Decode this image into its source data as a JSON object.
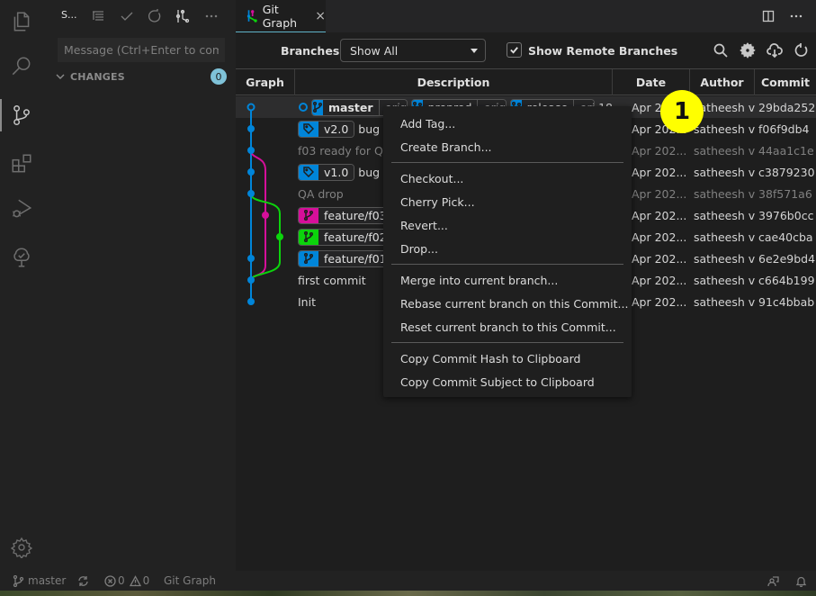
{
  "activity_bar": {
    "items": [
      {
        "name": "explorer",
        "icon": "files-icon"
      },
      {
        "name": "search",
        "icon": "search-icon"
      },
      {
        "name": "source-control",
        "icon": "source-control-icon",
        "active": true
      },
      {
        "name": "extensions",
        "icon": "extensions-icon"
      },
      {
        "name": "run-debug",
        "icon": "run-debug-icon"
      },
      {
        "name": "testing",
        "icon": "testing-tree-icon"
      }
    ],
    "settings_icon": "gear-icon"
  },
  "sidebar": {
    "title": "S...",
    "actions": [
      "view-as-tree-icon",
      "commit-check-icon",
      "refresh-icon",
      "git-graph-icon",
      "more-icon"
    ],
    "message_placeholder": "Message (Ctrl+Enter to com...",
    "changes_label": "CHANGES",
    "changes_count": "0"
  },
  "tab": {
    "label": "Git Graph",
    "close": "×"
  },
  "controls": {
    "branches_label": "Branches:",
    "branches_value": "Show All",
    "show_remote_label": "Show Remote Branches",
    "show_remote_checked": true
  },
  "table": {
    "headers": [
      "Graph",
      "Description",
      "Date",
      "Author",
      "Commit"
    ],
    "rows": [
      {
        "refs": [
          {
            "type": "branch",
            "name": "master",
            "remote": "origin",
            "color": "#0085d9",
            "bold": true
          },
          {
            "type": "branch",
            "name": "preprod",
            "remote": "origin",
            "color": "#0085d9"
          },
          {
            "type": "branch",
            "name": "release",
            "remote": "orig",
            "color": "#0085d9"
          }
        ],
        "message": "18",
        "date": "Apr 20...",
        "author": "satheesh v",
        "commit": "29bda252",
        "dim": false,
        "selected": true
      },
      {
        "refs": [
          {
            "type": "tag",
            "name": "v2.0",
            "color": "#0085d9"
          }
        ],
        "message": "bug fix",
        "date": "Apr 202...",
        "author": "satheesh v",
        "commit": "f06f9db4",
        "dim": false
      },
      {
        "refs": [],
        "message": "f03 ready for QA",
        "date": "Apr 202...",
        "author": "satheesh v",
        "commit": "44aa1c1e",
        "dim": true
      },
      {
        "refs": [
          {
            "type": "tag",
            "name": "v1.0",
            "color": "#0085d9"
          }
        ],
        "message": "bug fix",
        "date": "Apr 202...",
        "author": "satheesh v",
        "commit": "c3879230",
        "dim": false
      },
      {
        "refs": [],
        "message": "QA drop",
        "date": "Apr 202...",
        "author": "satheesh v",
        "commit": "38f571a6",
        "dim": true
      },
      {
        "refs": [
          {
            "type": "branch",
            "name": "feature/f03",
            "color": "#d60f9a"
          }
        ],
        "message": "",
        "date": "Apr 202...",
        "author": "satheesh v",
        "commit": "3976b0cc",
        "dim": false
      },
      {
        "refs": [
          {
            "type": "branch",
            "name": "feature/f02",
            "color": "#0cd40c"
          }
        ],
        "message": "",
        "date": "Apr 202...",
        "author": "satheesh v",
        "commit": "cae40cba",
        "dim": false
      },
      {
        "refs": [
          {
            "type": "branch",
            "name": "feature/f01",
            "color": "#0085d9"
          }
        ],
        "message": "",
        "date": "Apr 202...",
        "author": "satheesh v",
        "commit": "6e2e9bd4",
        "dim": false
      },
      {
        "refs": [],
        "message": "first commit",
        "date": "Apr 202...",
        "author": "satheesh v",
        "commit": "c664b199",
        "dim": false
      },
      {
        "refs": [],
        "message": "Init",
        "date": "Apr 202...",
        "author": "satheesh v",
        "commit": "91c4bbab",
        "dim": false
      }
    ]
  },
  "graph": {
    "colors": {
      "main": "#0085d9",
      "f03": "#d60f9a",
      "f02": "#0cd40c"
    }
  },
  "context_menu": {
    "groups": [
      [
        "Add Tag...",
        "Create Branch..."
      ],
      [
        "Checkout...",
        "Cherry Pick...",
        "Revert...",
        "Drop..."
      ],
      [
        "Merge into current branch...",
        "Rebase current branch on this Commit...",
        "Reset current branch to this Commit..."
      ],
      [
        "Copy Commit Hash to Clipboard",
        "Copy Commit Subject to Clipboard"
      ]
    ]
  },
  "annotation": {
    "label": "1",
    "color": "#ffff00"
  },
  "status_bar": {
    "branch": "master",
    "errors": "0",
    "warnings": "0",
    "git_graph": "Git Graph"
  }
}
